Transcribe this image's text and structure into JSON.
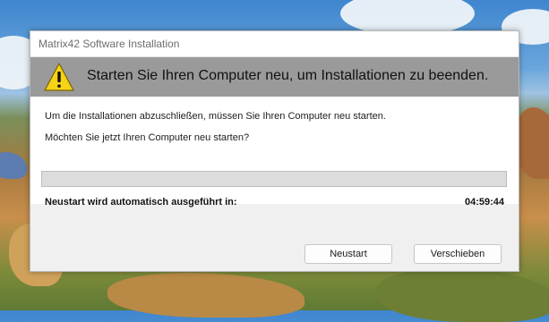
{
  "window": {
    "title": "Matrix42 Software Installation"
  },
  "banner": {
    "icon": "warning-icon",
    "text": "Starten Sie Ihren Computer neu, um Installationen zu beenden."
  },
  "message": {
    "line1": "Um die Installationen abzuschließen, müssen Sie Ihren Computer neu starten.",
    "line2": "Möchten Sie jetzt Ihren Computer neu starten?"
  },
  "progress": {
    "value": 0
  },
  "countdown": {
    "label": "Neustart wird automatisch ausgeführt in:",
    "value": "04:59:44"
  },
  "buttons": {
    "restart": "Neustart",
    "postpone": "Verschieben"
  },
  "colors": {
    "banner": "#9a9a9a",
    "warning": "#f5d316"
  }
}
